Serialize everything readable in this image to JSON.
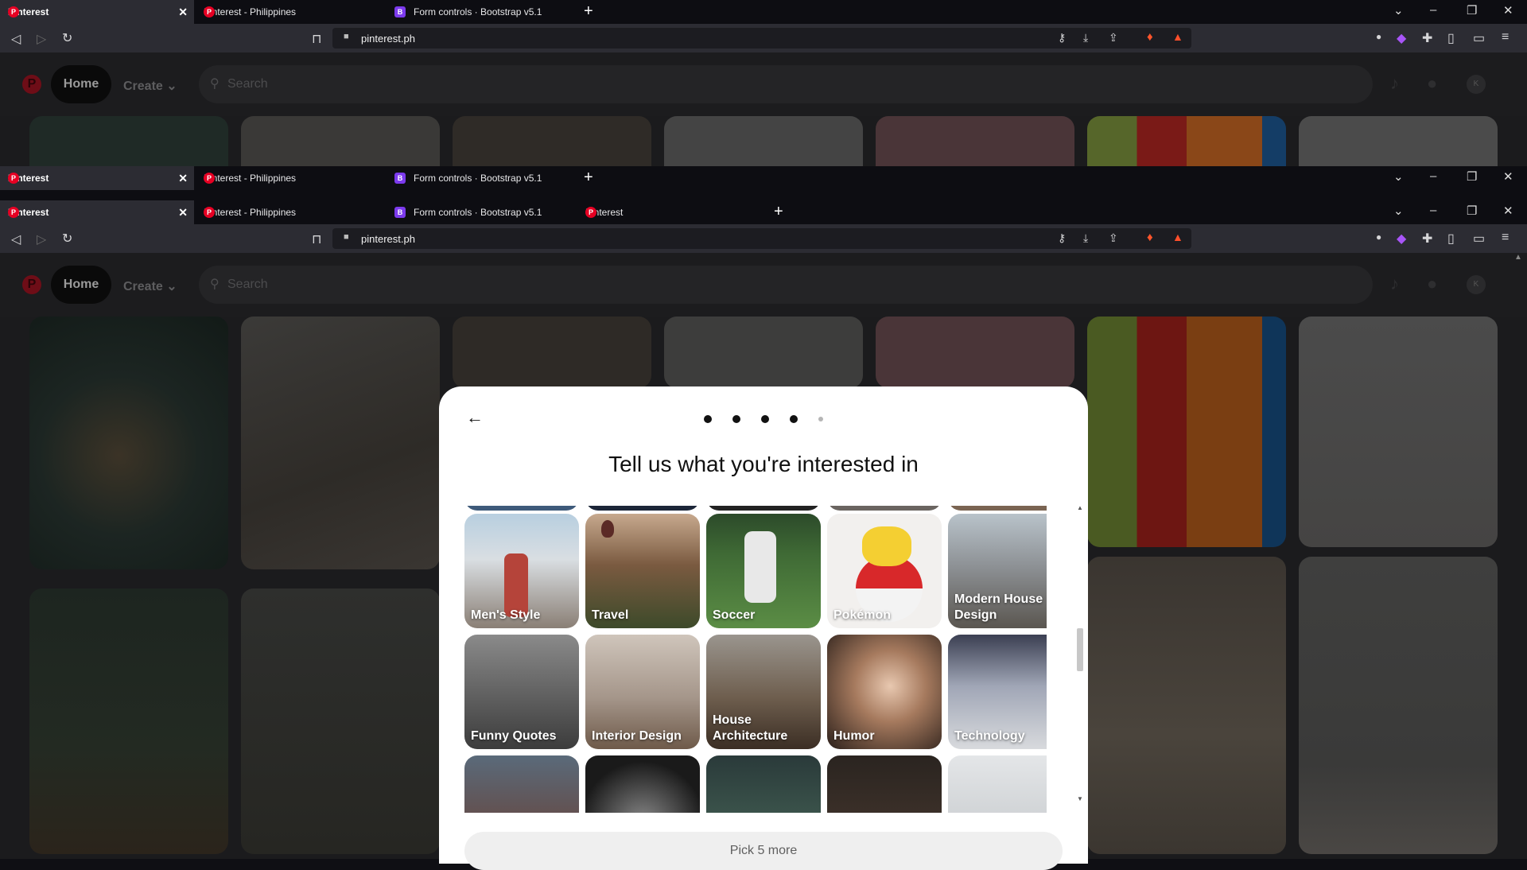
{
  "browser": {
    "tabs_top": [
      {
        "label": "Pinterest",
        "icon": "pinterest-icon"
      },
      {
        "label": "Pinterest - Philippines",
        "icon": "pinterest-icon"
      },
      {
        "label": "Form controls · Bootstrap v5.1",
        "icon": "bootstrap-icon"
      }
    ],
    "tabs_bottom": [
      {
        "label": "Pinterest",
        "icon": "pinterest-icon"
      },
      {
        "label": "Pinterest - Philippines",
        "icon": "pinterest-icon"
      },
      {
        "label": "Form controls · Bootstrap v5.1",
        "icon": "bootstrap-icon"
      },
      {
        "label": "Pinterest",
        "icon": "pinterest-icon"
      }
    ],
    "url": "pinterest.ph",
    "bootstrap_glyph": "B",
    "close_glyph": "✕",
    "newtab_glyph": "+"
  },
  "pinterest": {
    "logo": "P",
    "home": "Home",
    "create": "Create",
    "search_placeholder": "Search",
    "avatar_initial": "K"
  },
  "modal": {
    "title": "Tell us what you're interested in",
    "steps_total": 5,
    "steps_done": 4,
    "button": "Pick 5 more",
    "topics_row1": [
      "Men's Style",
      "Travel",
      "Soccer",
      "Pokémon",
      "Modern House Design"
    ],
    "topics_row2": [
      "Funny Quotes",
      "Interior Design",
      "House Architecture",
      "Humor",
      "Technology"
    ]
  },
  "colors": {
    "accent": "#e60023",
    "bootstrap": "#7c3aed"
  }
}
